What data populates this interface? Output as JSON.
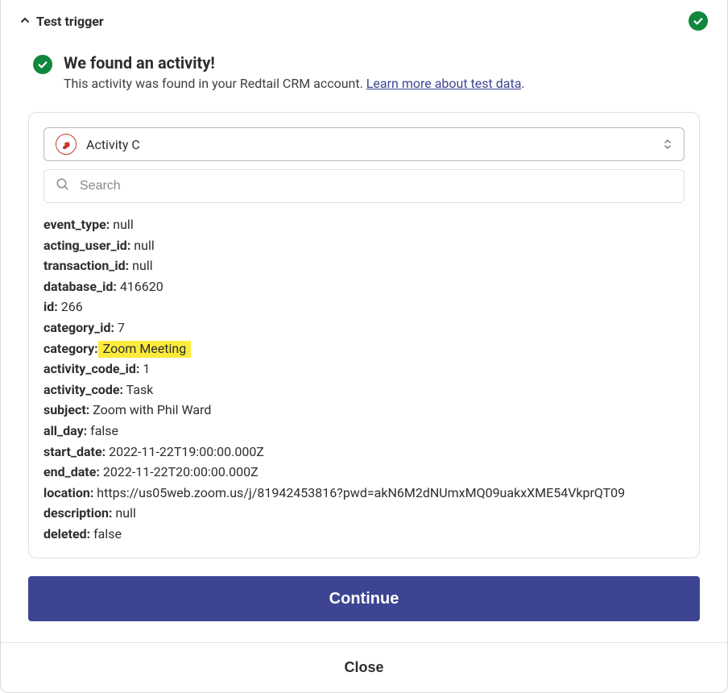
{
  "header": {
    "title": "Test trigger"
  },
  "message": {
    "title": "We found an activity!",
    "subtext_before": "This activity was found in your Redtail CRM account. ",
    "link_text": "Learn more about test data",
    "subtext_after": "."
  },
  "selector": {
    "label": "Activity C"
  },
  "search": {
    "placeholder": "Search"
  },
  "fields": [
    {
      "key": "event_type:",
      "value": " null",
      "highlight": false
    },
    {
      "key": "acting_user_id:",
      "value": " null",
      "highlight": false
    },
    {
      "key": "transaction_id:",
      "value": " null",
      "highlight": false
    },
    {
      "key": "database_id:",
      "value": " 416620",
      "highlight": false
    },
    {
      "key": "id:",
      "value": " 266",
      "highlight": false
    },
    {
      "key": "category_id:",
      "value": " 7",
      "highlight": false
    },
    {
      "key": "category:",
      "value": " Zoom Meeting",
      "highlight": true
    },
    {
      "key": "activity_code_id:",
      "value": " 1",
      "highlight": false
    },
    {
      "key": "activity_code:",
      "value": " Task",
      "highlight": false
    },
    {
      "key": "subject:",
      "value": " Zoom with Phil Ward",
      "highlight": false
    },
    {
      "key": "all_day:",
      "value": " false",
      "highlight": false
    },
    {
      "key": "start_date:",
      "value": " 2022-11-22T19:00:00.000Z",
      "highlight": false
    },
    {
      "key": "end_date:",
      "value": " 2022-11-22T20:00:00.000Z",
      "highlight": false
    },
    {
      "key": "location:",
      "value": " https://us05web.zoom.us/j/81942453816?pwd=akN6M2dNUmxMQ09uakxXME54VkprQT09",
      "highlight": false
    },
    {
      "key": "description:",
      "value": " null",
      "highlight": false
    },
    {
      "key": "deleted:",
      "value": " false",
      "highlight": false
    }
  ],
  "buttons": {
    "continue": "Continue",
    "close": "Close"
  }
}
